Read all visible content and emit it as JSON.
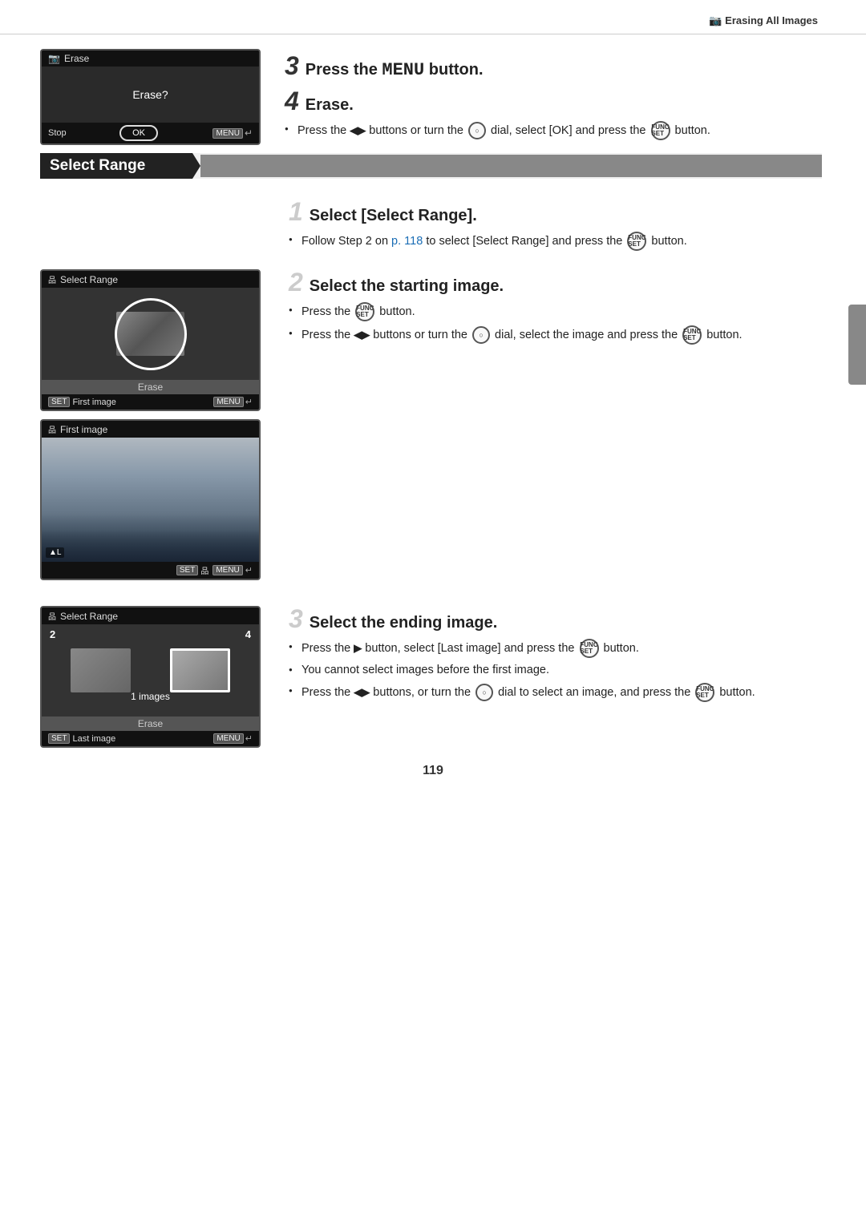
{
  "header": {
    "icon": "📷",
    "title": "Erasing All Images"
  },
  "step3": {
    "num": "3",
    "title": "Press the ",
    "menu_word": "MENU",
    "title_end": " button."
  },
  "step4": {
    "num": "4",
    "title": "Erase.",
    "bullets": [
      "Press the ◀▶ buttons or turn the dial, select [OK] and press the button."
    ]
  },
  "erase_screen": {
    "title": "Erase",
    "question": "Erase?",
    "stop": "Stop",
    "ok": "OK",
    "menu": "MENU",
    "return": "↵"
  },
  "section_label": "Select Range",
  "sr_step1": {
    "num": "1",
    "title": "Select [Select Range].",
    "bullets": [
      "Follow Step 2 on p. 118 to select [Select Range] and press the button."
    ],
    "link_text": "p. 118"
  },
  "sr_step2": {
    "num": "2",
    "title": "Select the starting image.",
    "bullets": [
      "Press the button.",
      "Press the ◀▶ buttons or turn the dial, select the image and press the button."
    ]
  },
  "sr_screen1": {
    "title": "Select Range",
    "erase": "Erase",
    "first_image": "First image",
    "menu": "MENU",
    "return": "↵"
  },
  "fi_screen": {
    "title": "First image",
    "bottom": "SET 品 MENU ↵"
  },
  "sr_step3": {
    "num": "3",
    "title": "Select the ending image.",
    "bullets": [
      "Press the ▶ button, select [Last image] and press the button.",
      "You cannot select images before the first image.",
      "Press the ◀▶ buttons, or turn the dial to select an image, and press the button."
    ]
  },
  "lr_screen": {
    "title": "Select Range",
    "num_left": "2",
    "num_right": "4",
    "count": "1 images",
    "erase": "Erase",
    "last_image": "Last image",
    "menu": "MENU",
    "return": "↵"
  },
  "page_number": "119"
}
